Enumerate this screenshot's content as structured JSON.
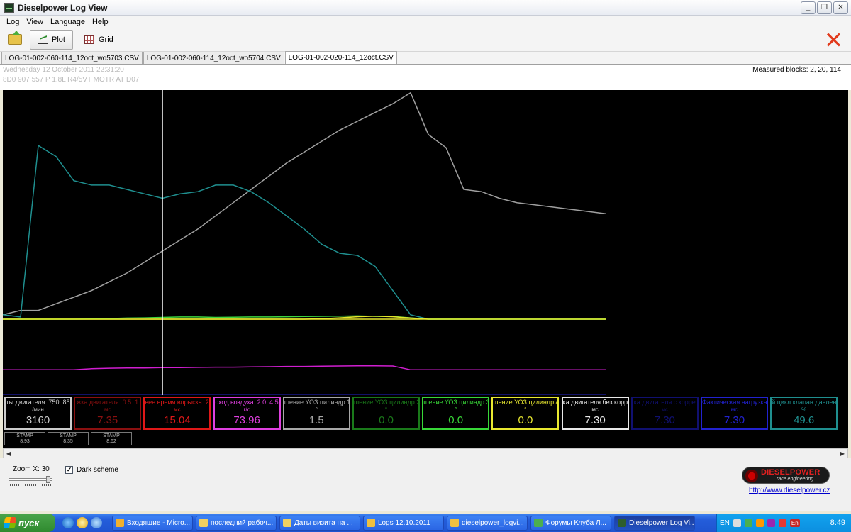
{
  "window": {
    "title": "Dieselpower Log View",
    "controls": [
      "_",
      "❐",
      "✕"
    ]
  },
  "menu": [
    "Log",
    "View",
    "Language",
    "Help"
  ],
  "toolbar": {
    "plot_label": "Plot",
    "grid_label": "Grid"
  },
  "tabs": [
    {
      "label": "LOG-01-002-060-114_12oct_wo5703.CSV",
      "active": false
    },
    {
      "label": "LOG-01-002-060-114_12oct_wo5704.CSV",
      "active": false
    },
    {
      "label": "LOG-01-002-020-114_12oct.CSV",
      "active": true
    }
  ],
  "info": {
    "date": "Wednesday 12 October 2011 22:31:20",
    "ecu": "8D0 907 557 P  1.8L R4/5VT MOTR AT D07",
    "measured_blocks": "Measured blocks: 2, 20, 114"
  },
  "chart_data": {
    "type": "line",
    "x": [
      0,
      1,
      2,
      3,
      4,
      5,
      6,
      7,
      8,
      9,
      10,
      11,
      12,
      13,
      14,
      15,
      16,
      17,
      18,
      19,
      20,
      21,
      22,
      23,
      24,
      25,
      26,
      27,
      28,
      29,
      30,
      31,
      32,
      33,
      34
    ],
    "series": [
      {
        "color": "#a0a0a0",
        "values": [
          2,
          4,
          4,
          7,
          10,
          13,
          17,
          21,
          26,
          31,
          36,
          41,
          47,
          53,
          59,
          65,
          71,
          76,
          81,
          86,
          90,
          94,
          98,
          103,
          84,
          78,
          59,
          58,
          55,
          53,
          52,
          51,
          50,
          49,
          48
        ]
      },
      {
        "color": "#1f8f8f",
        "values": [
          2,
          1,
          79,
          74,
          63,
          61,
          61,
          59,
          57,
          55,
          57,
          58,
          61,
          61,
          58,
          53,
          47,
          41,
          34,
          30,
          29,
          24,
          13,
          2,
          0,
          0,
          0,
          0,
          0,
          0,
          0,
          0,
          0,
          0,
          0
        ]
      },
      {
        "color": "#3ed43e",
        "values": [
          0,
          0,
          0,
          0,
          0,
          0.1,
          0.3,
          0.5,
          0.6,
          0.8,
          1,
          1,
          0.8,
          0.9,
          1,
          1,
          1.1,
          1.2,
          1.3,
          1.4,
          1.5,
          1.3,
          1.2,
          0.6,
          0,
          0,
          0,
          0,
          0,
          0,
          0,
          0,
          0,
          0,
          0
        ]
      },
      {
        "color": "#e6e62a",
        "values": [
          0,
          0,
          0,
          0,
          0,
          0,
          0,
          0,
          0,
          0,
          0,
          0,
          0,
          0,
          0,
          0,
          0,
          0,
          0.2,
          0.6,
          1.1,
          1.4,
          1.1,
          0.5,
          0,
          0,
          0,
          0,
          0,
          0,
          0,
          0,
          0,
          0,
          0
        ]
      },
      {
        "color": "#d01ed0",
        "values": [
          -23,
          -23,
          -23,
          -23,
          -23,
          -22.5,
          -22.3,
          -22.2,
          -22.2,
          -22,
          -22,
          -21.9,
          -21.8,
          -21.8,
          -21.7,
          -21.6,
          -21.5,
          -21.5,
          -21.4,
          -21.3,
          -21.2,
          -21.2,
          -21.3,
          -23,
          -23,
          -23,
          -23,
          -23,
          -23,
          -23,
          -23,
          -23,
          -23,
          -23,
          -23
        ]
      }
    ],
    "cursor_x": 9
  },
  "gauges": [
    {
      "name": "ты двигателя: 750..85",
      "unit": "/мин",
      "value": "3160",
      "color": "#cccccc"
    },
    {
      "name": "жка двигателя: 0.5..1",
      "unit": "мс",
      "value": "7.35",
      "color": "#8b1010"
    },
    {
      "name": "вее время впрыска: 2.",
      "unit": "мс",
      "value": "15.04",
      "color": "#e01818"
    },
    {
      "name": "сход воздуха: 2.0..4.5",
      "unit": "г/с",
      "value": "73.96",
      "color": "#e040e0"
    },
    {
      "name": "шение УОЗ цилиндр 1",
      "unit": "°",
      "value": "1.5",
      "color": "#a8a8a8"
    },
    {
      "name": "шение УОЗ цилиндр 2",
      "unit": "°",
      "value": "0.0",
      "color": "#1a7a1a"
    },
    {
      "name": "шение УОЗ цилиндр 3",
      "unit": "°",
      "value": "0.0",
      "color": "#38d838"
    },
    {
      "name": "шение УОЗ цилиндр 4",
      "unit": "°",
      "value": "0.0",
      "color": "#e8e830"
    },
    {
      "name": "ка двигателя без корр",
      "unit": "мс",
      "value": "7.30",
      "color": "#e8e8e8"
    },
    {
      "name": "ка двигателя с корре",
      "unit": "мс",
      "value": "7.30",
      "color": "#101070"
    },
    {
      "name": "Фактическая нагрузка",
      "unit": "мс",
      "value": "7.30",
      "color": "#2222d0"
    },
    {
      "name": "й цикл клапан давлен",
      "unit": "%",
      "value": "49.6",
      "color": "#1f8f8f"
    }
  ],
  "stamps": [
    {
      "label": "STAMP",
      "value": "8.93"
    },
    {
      "label": "STAMP",
      "value": "8.35"
    },
    {
      "label": "STAMP",
      "value": "8.62"
    }
  ],
  "bottom": {
    "zoom_label": "Zoom X: 30",
    "zoom_level": 0.95,
    "dark_scheme_label": "Dark scheme",
    "dark_scheme_checked": true,
    "logo_brand": "DIESELPOWER",
    "logo_sub": "race engineering",
    "website": "http://www.dieselpower.cz"
  },
  "taskbar": {
    "start_label": "пуск",
    "tasks": [
      {
        "label": "Входящие - Micro...",
        "color": "#f0b030",
        "active": false
      },
      {
        "label": "последний рабоч...",
        "color": "#f0d060",
        "active": false
      },
      {
        "label": "Даты визита на ...",
        "color": "#f0d060",
        "active": false
      },
      {
        "label": "Logs 12.10.2011",
        "color": "#f0c040",
        "active": false
      },
      {
        "label": "dieselpower_logvi...",
        "color": "#f0c040",
        "active": false
      },
      {
        "label": "Форумы Клуба Л...",
        "color": "#4caf50",
        "active": false
      },
      {
        "label": "Dieselpower Log Vi...",
        "color": "#2e5e2e",
        "active": true
      }
    ],
    "language": "EN",
    "lang_badge": "En",
    "clock": "8:49"
  }
}
